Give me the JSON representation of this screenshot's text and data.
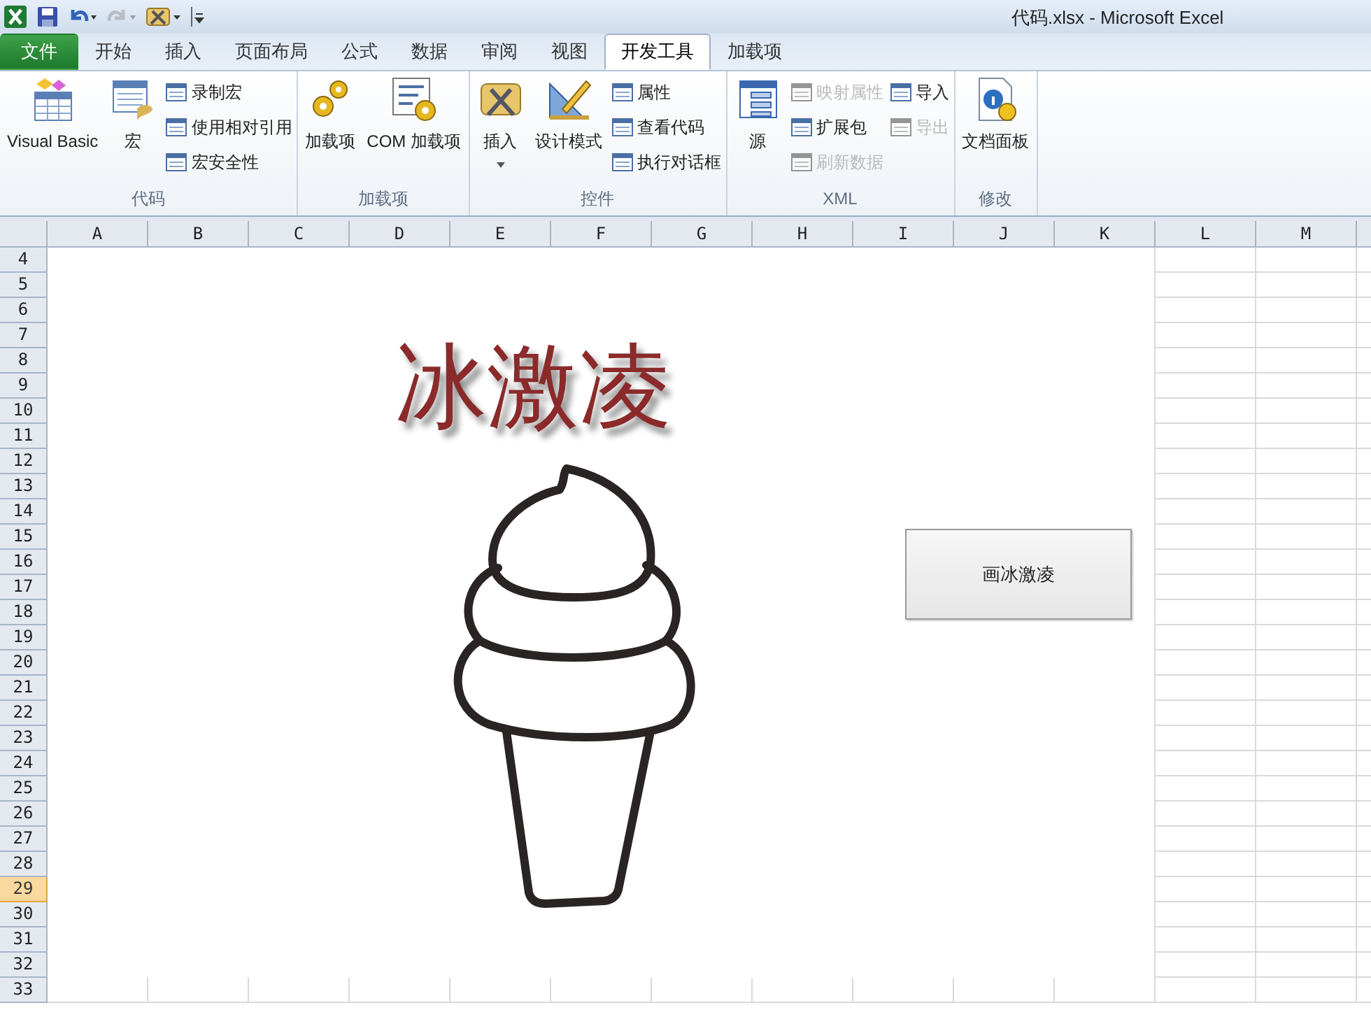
{
  "window": {
    "title": "代码.xlsx  -  Microsoft Excel"
  },
  "tabs": [
    {
      "label": "文件",
      "kind": "file",
      "selected": false
    },
    {
      "label": "开始",
      "kind": "tab",
      "selected": false
    },
    {
      "label": "插入",
      "kind": "tab",
      "selected": false
    },
    {
      "label": "页面布局",
      "kind": "tab",
      "selected": false
    },
    {
      "label": "公式",
      "kind": "tab",
      "selected": false
    },
    {
      "label": "数据",
      "kind": "tab",
      "selected": false
    },
    {
      "label": "审阅",
      "kind": "tab",
      "selected": false
    },
    {
      "label": "视图",
      "kind": "tab",
      "selected": false
    },
    {
      "label": "开发工具",
      "kind": "tab",
      "selected": true
    },
    {
      "label": "加载项",
      "kind": "tab",
      "selected": false
    }
  ],
  "ribbon": {
    "groups": [
      {
        "label": "代码",
        "columns": [
          {
            "kind": "large",
            "label": "Visual Basic",
            "dropdown": false
          },
          {
            "kind": "large",
            "label": "宏",
            "dropdown": false
          },
          {
            "kind": "stack",
            "items": [
              {
                "label": "录制宏",
                "disabled": false
              },
              {
                "label": "使用相对引用",
                "disabled": false
              },
              {
                "label": "宏安全性",
                "disabled": false
              }
            ]
          }
        ]
      },
      {
        "label": "加载项",
        "columns": [
          {
            "kind": "large",
            "label": "加载项",
            "dropdown": false
          },
          {
            "kind": "large",
            "label": "COM 加载项",
            "dropdown": false
          }
        ]
      },
      {
        "label": "控件",
        "columns": [
          {
            "kind": "large",
            "label": "插入",
            "dropdown": true
          },
          {
            "kind": "large",
            "label": "设计模式",
            "dropdown": false
          },
          {
            "kind": "stack",
            "items": [
              {
                "label": "属性",
                "disabled": false
              },
              {
                "label": "查看代码",
                "disabled": false
              },
              {
                "label": "执行对话框",
                "disabled": false
              }
            ]
          }
        ]
      },
      {
        "label": "XML",
        "columns": [
          {
            "kind": "large",
            "label": "源",
            "dropdown": false
          },
          {
            "kind": "stack",
            "items": [
              {
                "label": "映射属性",
                "disabled": true
              },
              {
                "label": "扩展包",
                "disabled": false
              },
              {
                "label": "刷新数据",
                "disabled": true
              }
            ]
          },
          {
            "kind": "stack",
            "items": [
              {
                "label": "导入",
                "disabled": false
              },
              {
                "label": "导出",
                "disabled": true
              }
            ]
          }
        ]
      },
      {
        "label": "修改",
        "columns": [
          {
            "kind": "large",
            "label": "文档面板",
            "dropdown": false
          }
        ]
      }
    ]
  },
  "sheet": {
    "columns": [
      "A",
      "B",
      "C",
      "D",
      "E",
      "F",
      "G",
      "H",
      "I",
      "J",
      "K",
      "L",
      "M"
    ],
    "rows": [
      {
        "label": "4",
        "selected": false
      },
      {
        "label": "5",
        "selected": false
      },
      {
        "label": "6",
        "selected": false
      },
      {
        "label": "7",
        "selected": false
      },
      {
        "label": "8",
        "selected": false
      },
      {
        "label": "9",
        "selected": false
      },
      {
        "label": "10",
        "selected": false
      },
      {
        "label": "11",
        "selected": false
      },
      {
        "label": "12",
        "selected": false
      },
      {
        "label": "13",
        "selected": false
      },
      {
        "label": "14",
        "selected": false
      },
      {
        "label": "15",
        "selected": false
      },
      {
        "label": "16",
        "selected": false
      },
      {
        "label": "17",
        "selected": false
      },
      {
        "label": "18",
        "selected": false
      },
      {
        "label": "19",
        "selected": false
      },
      {
        "label": "20",
        "selected": false
      },
      {
        "label": "21",
        "selected": false
      },
      {
        "label": "22",
        "selected": false
      },
      {
        "label": "23",
        "selected": false
      },
      {
        "label": "24",
        "selected": false
      },
      {
        "label": "25",
        "selected": false
      },
      {
        "label": "26",
        "selected": false
      },
      {
        "label": "27",
        "selected": false
      },
      {
        "label": "28",
        "selected": false
      },
      {
        "label": "29",
        "selected": true
      },
      {
        "label": "30",
        "selected": false
      },
      {
        "label": "31",
        "selected": false
      },
      {
        "label": "32",
        "selected": false
      },
      {
        "label": "33",
        "selected": false
      }
    ],
    "canvas": {
      "wordart": "冰激凌",
      "button": "画冰激凌"
    }
  }
}
